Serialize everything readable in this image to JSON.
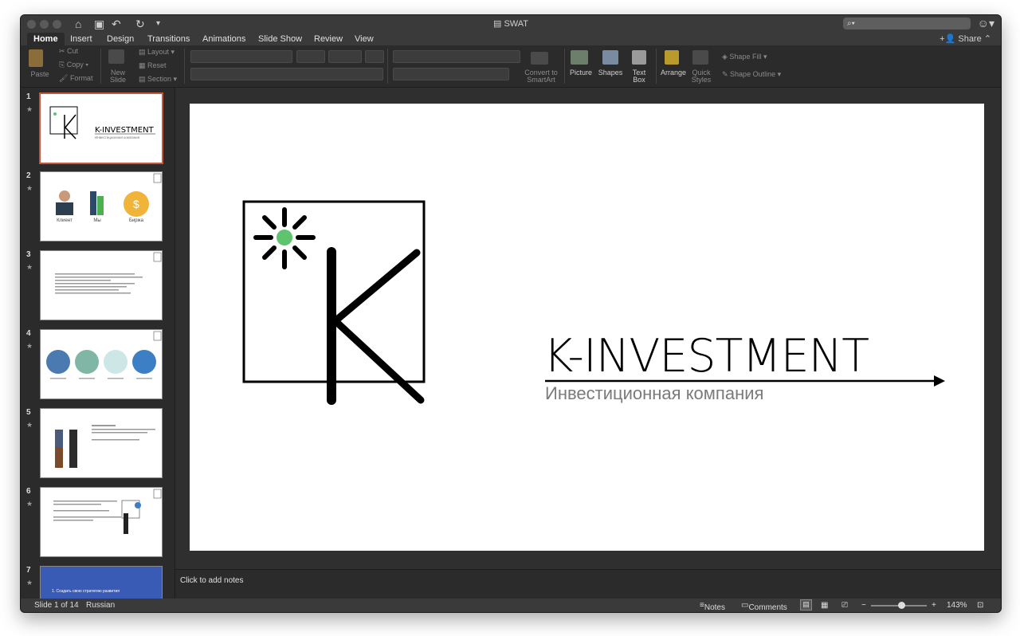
{
  "window": {
    "title": "SWAT",
    "search_placeholder": ""
  },
  "tabs": [
    "Home",
    "Insert",
    "Design",
    "Transitions",
    "Animations",
    "Slide Show",
    "Review",
    "View"
  ],
  "share_label": "Share",
  "ribbon": {
    "paste": "Paste",
    "cut": "Cut",
    "copy": "Copy",
    "format": "Format",
    "new_slide": "New\nSlide",
    "layout": "Layout",
    "reset": "Reset",
    "section": "Section",
    "convert": "Convert to\nSmartArt",
    "picture": "Picture",
    "shapes": "Shapes",
    "textbox": "Text\nBox",
    "arrange": "Arrange",
    "quick_styles": "Quick\nStyles",
    "shape_fill": "Shape Fill",
    "shape_outline": "Shape Outline"
  },
  "slides": [
    {
      "num": "1"
    },
    {
      "num": "2"
    },
    {
      "num": "3"
    },
    {
      "num": "4"
    },
    {
      "num": "5"
    },
    {
      "num": "6"
    },
    {
      "num": "7"
    }
  ],
  "slide1": {
    "letter": "K",
    "company": "K-INVESTMENT",
    "subtitle": "Инвестиционная компания"
  },
  "thumb2": {
    "labels": [
      "Клиент",
      "Мы",
      "Биржа"
    ]
  },
  "thumb7": {
    "lines": [
      "1. Создать свою стратегию развития"
    ]
  },
  "notes_placeholder": "Click to add notes",
  "status": {
    "slide_info": "Slide 1 of 14",
    "language": "Russian",
    "notes": "Notes",
    "comments": "Comments",
    "zoom": "143%"
  },
  "colors": {
    "accent_green": "#5ec46e",
    "selection": "#c8553d"
  }
}
